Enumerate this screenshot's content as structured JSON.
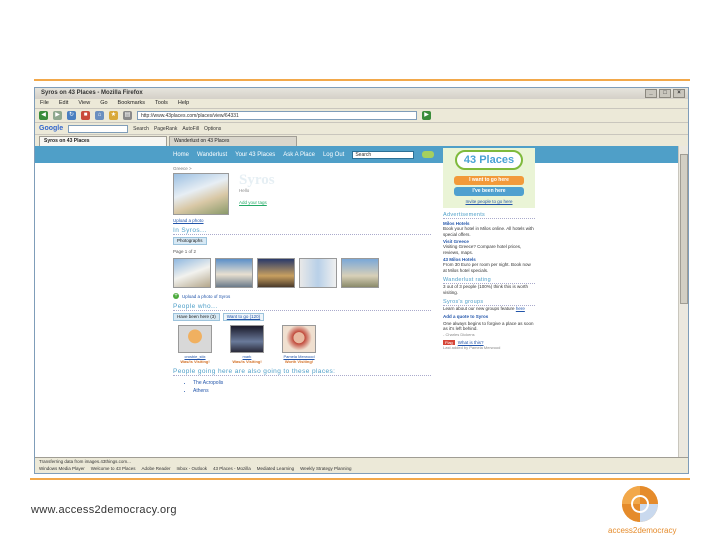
{
  "slide": {
    "footer_url": "www.access2democracy.org",
    "brand_name": "access2democracy"
  },
  "browser": {
    "title": "Syros on 43 Places - Mozilla Firefox",
    "menu": [
      "File",
      "Edit",
      "View",
      "Go",
      "Bookmarks",
      "Tools",
      "Help"
    ],
    "address": "http://www.43places.com/places/view/64331",
    "google_logo": "Google",
    "google_items": [
      "Search",
      "PageRank",
      "AutoFill",
      "Options"
    ],
    "tabs": [
      "Syros on 43 Places",
      "Wanderlust on 43 Places"
    ],
    "status": "Transferring data from images.43things.com...",
    "taskbar": [
      "Windows Media Player",
      "Welcome to 43 Places",
      "Adobe Reader",
      "Inbox - Outlook",
      "43 Places - Mozilla",
      "Mediated Learning",
      "Weekly Strategy Planning"
    ]
  },
  "site": {
    "nav": [
      "Home",
      "Wanderlust",
      "Your 43 Places",
      "Ask A Place",
      "Log Out"
    ],
    "search_placeholder": "Search"
  },
  "place": {
    "crumb": "Greece >",
    "title": "Syros",
    "subtitle": "Hello",
    "add_tag": "Add your tags",
    "upload_link": "Upload a photo",
    "in_head": "In Syros...",
    "photo_chip": "Photographs",
    "pager": "Page 1 of 2",
    "upload_photo": "Upload a photo of Syros",
    "people_head": "People who...",
    "people_chips": [
      "Have been here (3)",
      "Want to go (120)"
    ],
    "people": [
      {
        "name": "crosbie_stix",
        "status": "Was/is Visiting!"
      },
      {
        "name": "mark",
        "status": "Was/is Visiting!"
      },
      {
        "name": "Pamela Merwood",
        "status": "Worth Visiting!"
      }
    ],
    "also_head": "People going here are also going to these places:",
    "also": [
      "The Acropolis",
      "Athens"
    ]
  },
  "sidebar": {
    "logo": "43 Places",
    "want_label": "I want to go here",
    "been_label": "I've been here",
    "invite": "Invite people to go here",
    "ads_head": "Advertisements",
    "ads": [
      {
        "title": "Milos Hotels",
        "text": "Book your hotel in Milos online. All hotels with special offers."
      },
      {
        "title": "Visit Greece",
        "text": "Visiting Greece? Compare hotel prices, reviews, maps."
      },
      {
        "title": "43 Milos Hotels",
        "text": "From 30 Euro per room per night. Book now at Milos hotel specials."
      }
    ],
    "wander_head": "Wanderlust rating",
    "wander_text": "3 out of 3 people (100%) think this is worth visiting.",
    "groups_head": "Syros's groups",
    "groups_text": "Learn about our new groups feature",
    "groups_link": "here",
    "quote_link": "Add a quote to Syros",
    "quote": "One always begins to forgive a place as soon as it's left behind.",
    "quote_by": "- Charles Dickens",
    "flag": "Flag",
    "flag_text": "What is this?",
    "added_by": "Last added by Pamela Merwood"
  },
  "colors": {
    "accent_orange": "#f2a84a",
    "nav_blue": "#4f9fc8",
    "green": "#7fba3c"
  }
}
